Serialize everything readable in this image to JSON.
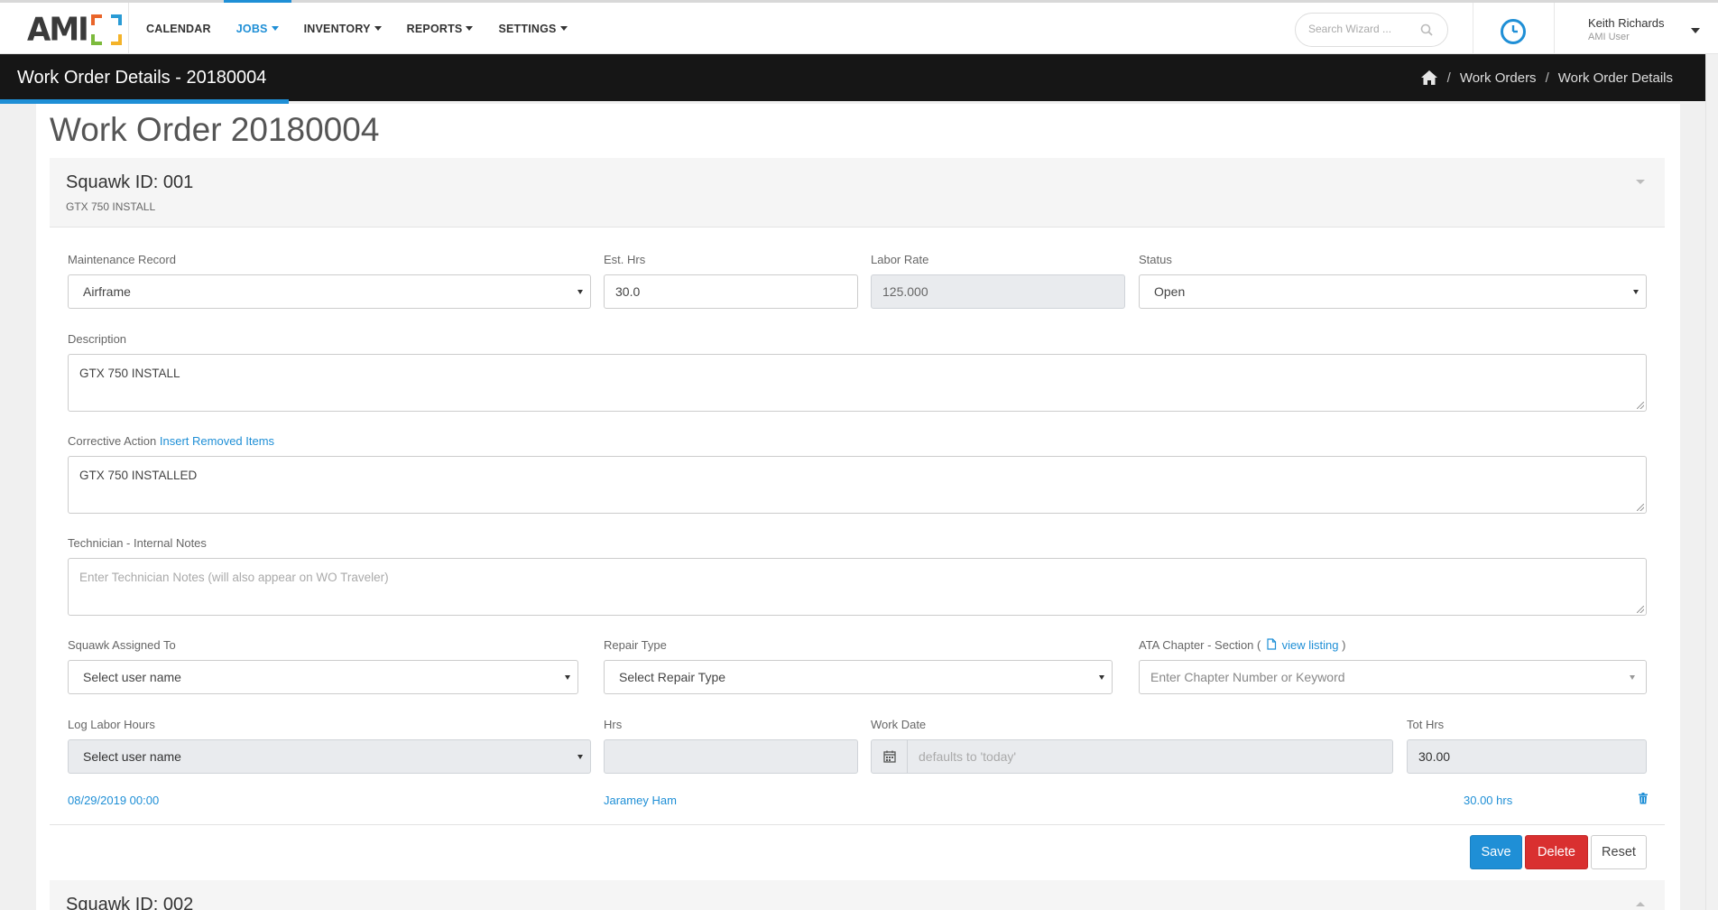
{
  "nav": {
    "logo_text": "AMI",
    "menu": [
      {
        "label": "CALENDAR",
        "dropdown": false
      },
      {
        "label": "JOBS",
        "dropdown": true,
        "active": true
      },
      {
        "label": "INVENTORY",
        "dropdown": true
      },
      {
        "label": "REPORTS",
        "dropdown": true
      },
      {
        "label": "SETTINGS",
        "dropdown": true
      }
    ],
    "search_placeholder": "Search Wizard ...",
    "user_name": "Keith Richards",
    "user_role": "AMI User",
    "accent": "#1f8fd6"
  },
  "titlebar": {
    "title": "Work Order Details - 20180004",
    "breadcrumb": [
      "Work Orders",
      "Work Order Details"
    ]
  },
  "page": {
    "title": "Work Order 20180004"
  },
  "squawk": {
    "title": "Squawk ID: 001",
    "subtitle": "GTX 750 INSTALL",
    "maintenance_record_label": "Maintenance Record",
    "maintenance_record_value": "Airframe",
    "est_hrs_label": "Est. Hrs",
    "est_hrs_value": "30.0",
    "labor_rate_label": "Labor Rate",
    "labor_rate_value": "125.000",
    "status_label": "Status",
    "status_value": "Open",
    "description_label": "Description",
    "description_value": "GTX 750 INSTALL",
    "corrective_action_label": "Corrective Action",
    "insert_removed_items_link": "Insert Removed Items",
    "corrective_action_value": "GTX 750 INSTALLED",
    "tech_notes_label": "Technician - Internal Notes",
    "tech_notes_placeholder": "Enter Technician Notes (will also appear on WO Traveler)",
    "assigned_to_label": "Squawk Assigned To",
    "assigned_to_value": "Select user name",
    "repair_type_label": "Repair Type",
    "repair_type_value": "Select Repair Type",
    "ata_label_prefix": "ATA Chapter - Section (",
    "ata_view_listing": "view listing",
    "ata_label_suffix": ")",
    "ata_placeholder": "Enter Chapter Number or Keyword",
    "log_labor_label": "Log Labor Hours",
    "log_labor_value": "Select user name",
    "hrs_label": "Hrs",
    "hrs_value": "",
    "work_date_label": "Work Date",
    "work_date_placeholder": "defaults to 'today'",
    "tot_hrs_label": "Tot Hrs",
    "tot_hrs_value": "30.00",
    "labor_entries": [
      {
        "date": "08/29/2019 00:00",
        "tech": "Jaramey Ham",
        "hours": "30.00 hrs"
      }
    ],
    "buttons": {
      "save": "Save",
      "delete": "Delete",
      "reset": "Reset"
    }
  },
  "squawk2": {
    "title": "Squawk ID: 002"
  }
}
